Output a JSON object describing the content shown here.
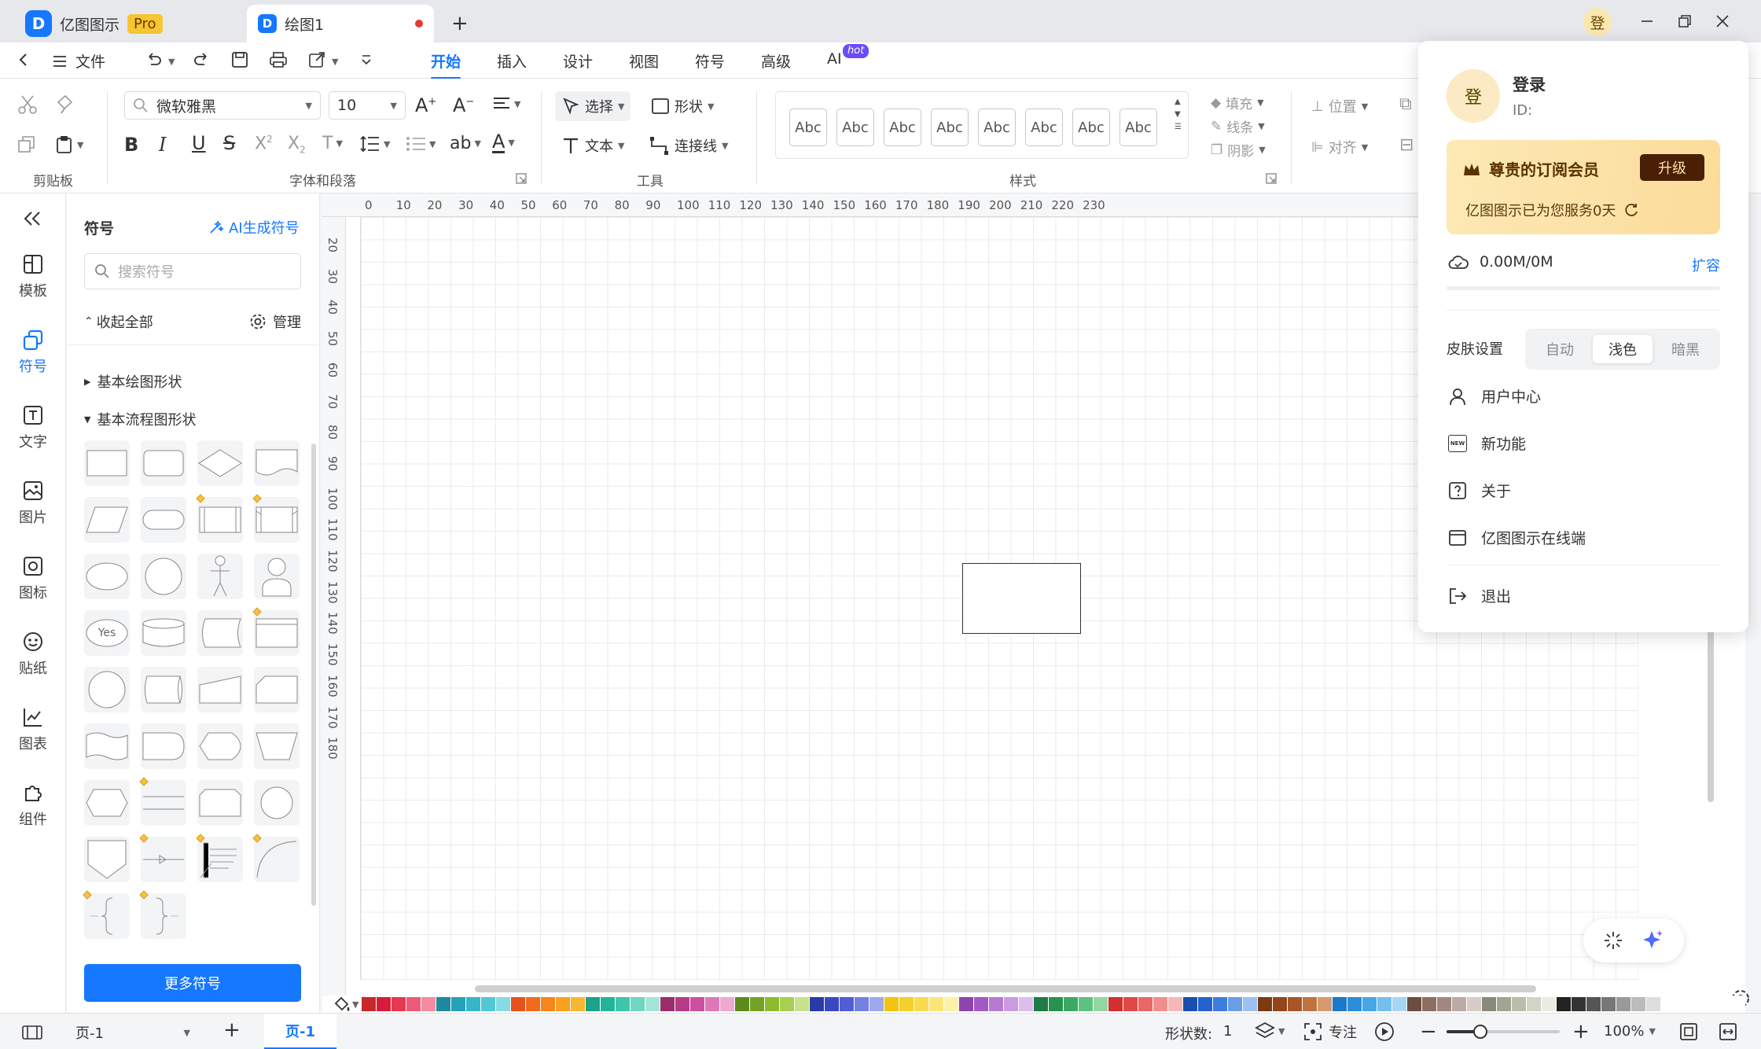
{
  "titlebar": {
    "app_name": "亿图图示",
    "pro_badge": "Pro",
    "doc_tab": "绘图1",
    "new_tab": "+",
    "avatar_char": "登"
  },
  "menubar": {
    "file": "文件",
    "tabs": [
      "开始",
      "插入",
      "设计",
      "视图",
      "符号",
      "高级",
      "AI"
    ],
    "hot_badge": "hot"
  },
  "ribbon": {
    "font_name": "微软雅黑",
    "font_size": "10",
    "select_label": "选择",
    "shape_label": "形状",
    "text_label": "文本",
    "connector_label": "连接线",
    "style_samples": [
      "Abc",
      "Abc",
      "Abc",
      "Abc",
      "Abc",
      "Abc",
      "Abc",
      "Abc"
    ],
    "fill_label": "填充",
    "line_label": "线条",
    "shadow_label": "阴影",
    "position_label": "位置",
    "align_label": "对齐",
    "groups": {
      "clipboard": "剪贴板",
      "font_para": "字体和段落",
      "tools": "工具",
      "styles": "样式"
    }
  },
  "leftnav": {
    "items": [
      "模板",
      "符号",
      "文字",
      "图片",
      "图标",
      "贴纸",
      "图表",
      "组件"
    ],
    "active": "符号"
  },
  "symbol_panel": {
    "title": "符号",
    "ai_generate": "AI生成符号",
    "search_placeholder": "搜索符号",
    "collapse_all": "收起全部",
    "manage": "管理",
    "category_basic_drawing": "基本绘图形状",
    "category_basic_flow": "基本流程图形状",
    "yes_label": "Yes",
    "more_button": "更多符号"
  },
  "ruler": {
    "h_ticks": [
      "0",
      "10",
      "20",
      "30",
      "40",
      "50",
      "60",
      "70",
      "80",
      "90",
      "100",
      "110",
      "120",
      "130",
      "140",
      "150",
      "160",
      "170",
      "180",
      "190",
      "200",
      "210",
      "220",
      "230"
    ],
    "v_ticks": [
      "20",
      "30",
      "40",
      "50",
      "60",
      "70",
      "80",
      "90",
      "100",
      "110",
      "120",
      "130",
      "140",
      "150",
      "160",
      "170",
      "180"
    ]
  },
  "palette": {
    "colors": [
      "#c62828",
      "#d81b3a",
      "#e53950",
      "#ef5a7a",
      "#f48ca0",
      "#1f8a9e",
      "#27a1b8",
      "#35b6c9",
      "#52c8d6",
      "#86dbe4",
      "#e8511e",
      "#f06b1c",
      "#f5851c",
      "#f9a01e",
      "#f7b731",
      "#1aa38a",
      "#22b59a",
      "#3ec6ad",
      "#6ed6c1",
      "#a3e6d8",
      "#9b2d6b",
      "#b63b86",
      "#d04ea0",
      "#e077b8",
      "#efa8d2",
      "#5d8a1c",
      "#72a322",
      "#8cbc2e",
      "#a9cf52",
      "#c7e287",
      "#2b3aa8",
      "#3848c4",
      "#4f5ed8",
      "#7381e3",
      "#9ea8ee",
      "#f1c40f",
      "#f5cf2a",
      "#f8da4e",
      "#fbe57b",
      "#fdf0ab",
      "#8e44ad",
      "#a259c4",
      "#b67ad3",
      "#c99be0",
      "#dcbdeb",
      "#1e7b45",
      "#27924f",
      "#3aaa63",
      "#5fc17f",
      "#91d6a5",
      "#d32f2f",
      "#e04848",
      "#ea6767",
      "#f18d8d",
      "#f7b7b7",
      "#1a4fb0",
      "#2463cc",
      "#3d7ddc",
      "#6a9ee6",
      "#9cc0ef",
      "#7b3a10",
      "#93461a",
      "#aa5526",
      "#c0733f",
      "#d69a6e",
      "#1c78c8",
      "#2a8edb",
      "#46a7e7",
      "#74bfee",
      "#a6d6f4",
      "#6d4c41",
      "#8d6e63",
      "#a1887f",
      "#bcaaa4",
      "#d7ccc8",
      "#8a8a7a",
      "#a3a392",
      "#bcbcab",
      "#d4d4c6",
      "#ebebe2",
      "#222222",
      "#333333",
      "#555555",
      "#777777",
      "#999999",
      "#bbbbbb",
      "#dddddd"
    ]
  },
  "statusbar": {
    "page_select": "页-1",
    "page_tab": "页-1",
    "shape_count_label": "形状数:",
    "shape_count": "1",
    "focus_label": "专注",
    "zoom": "100%",
    "zoom_fraction": 0.3
  },
  "popup": {
    "login": "登录",
    "id_label": "ID:",
    "avatar_char": "登",
    "member_title": "尊贵的订阅会员",
    "upgrade": "升级",
    "service_days": "亿图图示已为您服务0天",
    "storage": "0.00M/0M",
    "expand": "扩容",
    "storage_fraction": 0,
    "skin_label": "皮肤设置",
    "skin_options": [
      "自动",
      "浅色",
      "暗黑"
    ],
    "skin_active": "浅色",
    "menu": [
      "用户中心",
      "新功能",
      "关于",
      "亿图图示在线端"
    ],
    "logout": "退出",
    "new_icon_text": "NEW"
  },
  "accent_color": "#1677ff",
  "member_gold": "#fbe4a8"
}
